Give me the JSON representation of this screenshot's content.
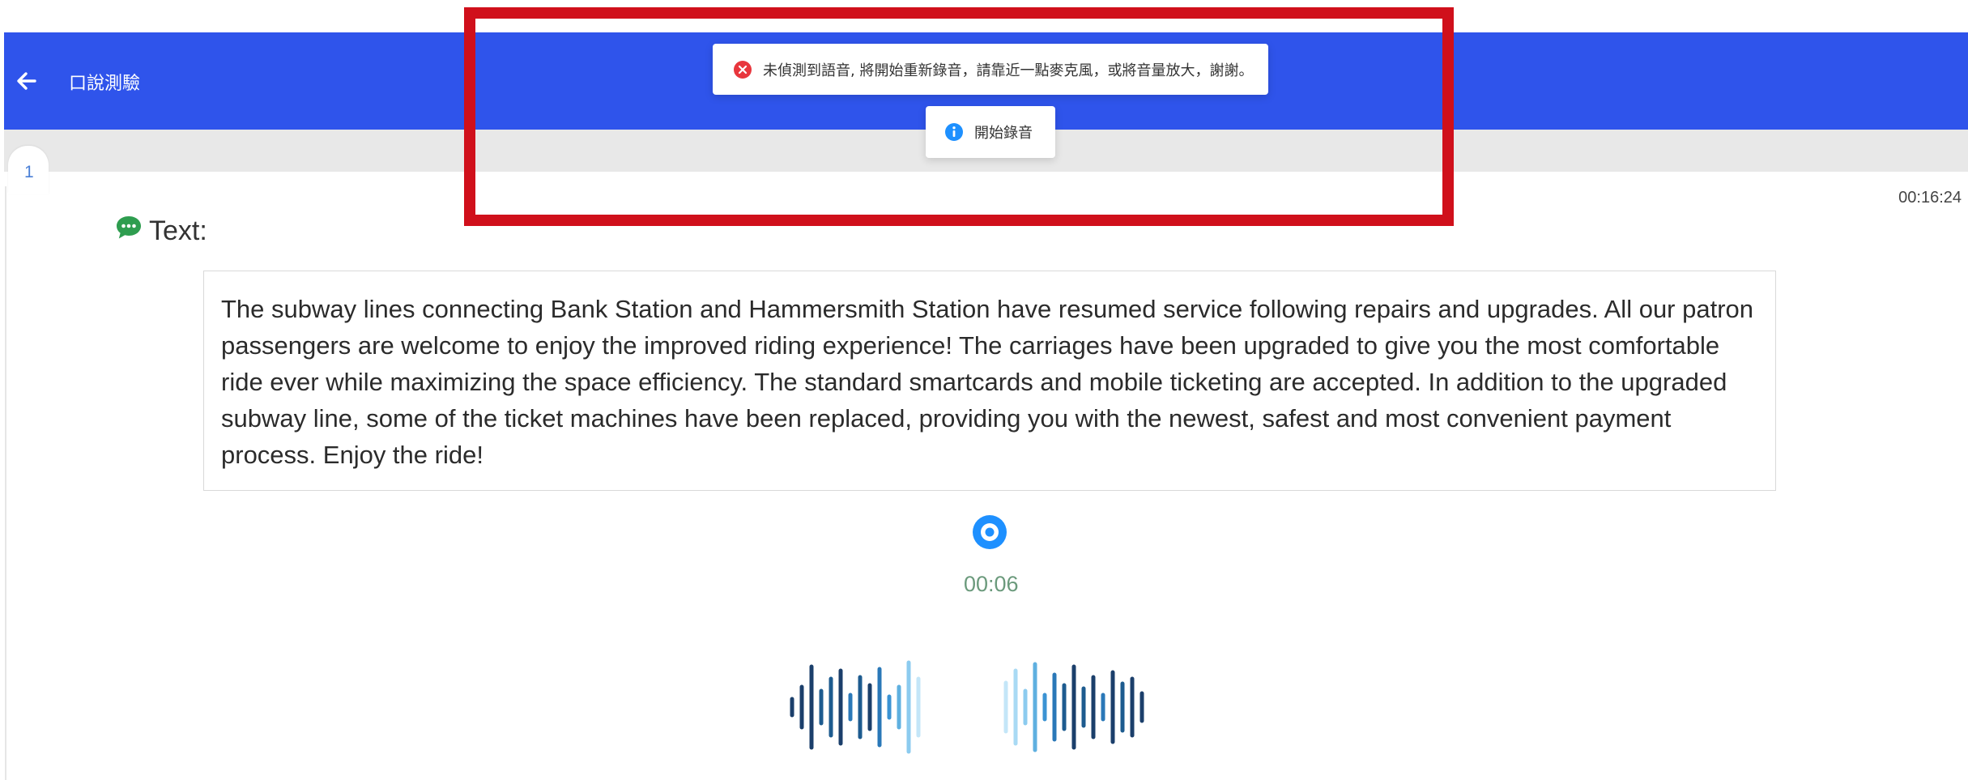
{
  "header": {
    "back_icon": "arrow-left-icon",
    "title": "口說測驗"
  },
  "question": {
    "number": "1"
  },
  "timer": "00:16:24",
  "section": {
    "icon": "chat-bubble-icon",
    "label": "Text:"
  },
  "passage": "The subway lines connecting Bank Station and Hammersmith Station have resumed service following repairs and upgrades. All our patron passengers are welcome to enjoy the improved riding experience! The carriages have been upgraded to give you the most comfortable ride ever while maximizing the space efficiency. The standard smartcards and mobile ticketing are accepted. In addition to the upgraded subway line, some of the ticket machines have been replaced, providing you with the newest, safest and most convenient payment process. Enjoy the ride!",
  "recorder": {
    "icon": "record-icon",
    "elapsed": "00:06",
    "waveform_icon": "audio-waveform-icon"
  },
  "toasts": {
    "error": {
      "icon": "error-circle-icon",
      "message": "未偵測到語音, 將開始重新錄音，請靠近一點麥克風，或將音量放大，謝謝。"
    },
    "info": {
      "icon": "info-circle-icon",
      "message": "開始錄音"
    }
  },
  "colors": {
    "header": "#2f54eb",
    "accent": "#1e90ff",
    "highlight": "#d0101b",
    "timer_text": "#6b9a7c",
    "error": "#e8363d",
    "chat_icon": "#2e9d4f"
  }
}
